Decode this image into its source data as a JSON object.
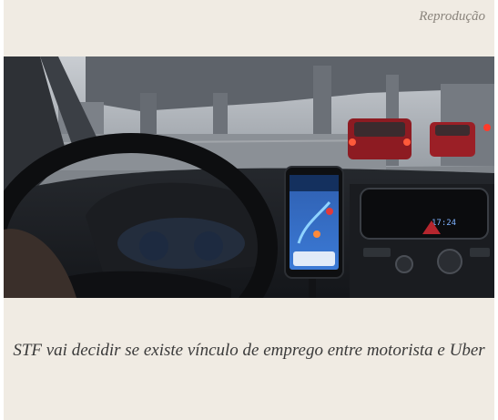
{
  "figure": {
    "credit": "Reprodução",
    "caption": "STF vai decidir se existe vínculo de emprego entre motorista e Uber",
    "image_description": "interior-of-car-with-phone-navigation"
  }
}
